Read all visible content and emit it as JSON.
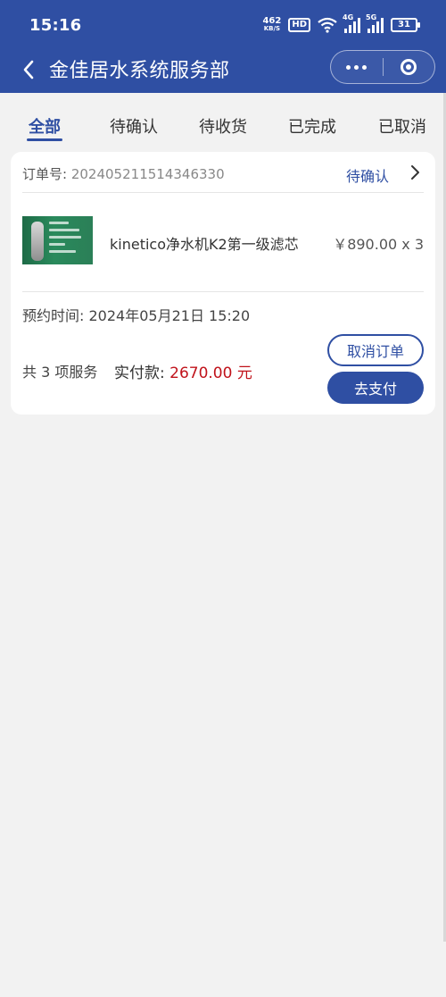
{
  "status_bar": {
    "time": "15:16",
    "net_speed_value": "462",
    "net_speed_unit": "KB/S",
    "hd_badge": "HD",
    "signal_1_tag": "4G",
    "signal_2_tag": "5G",
    "battery": "31"
  },
  "nav": {
    "title": "金佳居水系统服务部"
  },
  "tabs": [
    {
      "label": "全部",
      "active": true
    },
    {
      "label": "待确认"
    },
    {
      "label": "待收货"
    },
    {
      "label": "已完成"
    },
    {
      "label": "已取消"
    }
  ],
  "order": {
    "order_no_label": "订单号:",
    "order_no": "202405211514346330",
    "status": "待确认",
    "product_name": "kinetico净水机K2第一级滤芯",
    "product_price": "￥890.00 x 3",
    "appointment_label": "预约时间:",
    "appointment_time": "2024年05月21日 15:20",
    "service_count": "共 3 项服务",
    "paid_label": "实付款:",
    "paid_amount": "2670.00 元",
    "cancel_button": "取消订单",
    "pay_button": "去支付"
  },
  "colors": {
    "primary": "#2f4fa3",
    "price_red": "#c0121a",
    "background": "#f2f2f2"
  }
}
